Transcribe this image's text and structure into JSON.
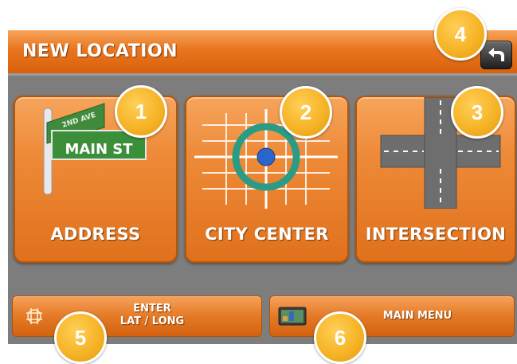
{
  "header": {
    "title": "NEW LOCATION"
  },
  "tiles": [
    {
      "label": "ADDRESS",
      "sign_text": "MAIN ST",
      "sign_small": "2ND AVE",
      "badge": "1"
    },
    {
      "label": "CITY CENTER",
      "badge": "2"
    },
    {
      "label": "INTERSECTION",
      "badge": "3"
    }
  ],
  "back": {
    "badge": "4"
  },
  "bottom": {
    "latlong": {
      "line1": "ENTER",
      "line2": "LAT / LONG",
      "badge": "5"
    },
    "menu": {
      "label": "MAIN MENU",
      "badge": "6"
    }
  },
  "colors": {
    "accent": "#e8751e",
    "badge": "#f6b427",
    "background": "#7d7d7d"
  }
}
